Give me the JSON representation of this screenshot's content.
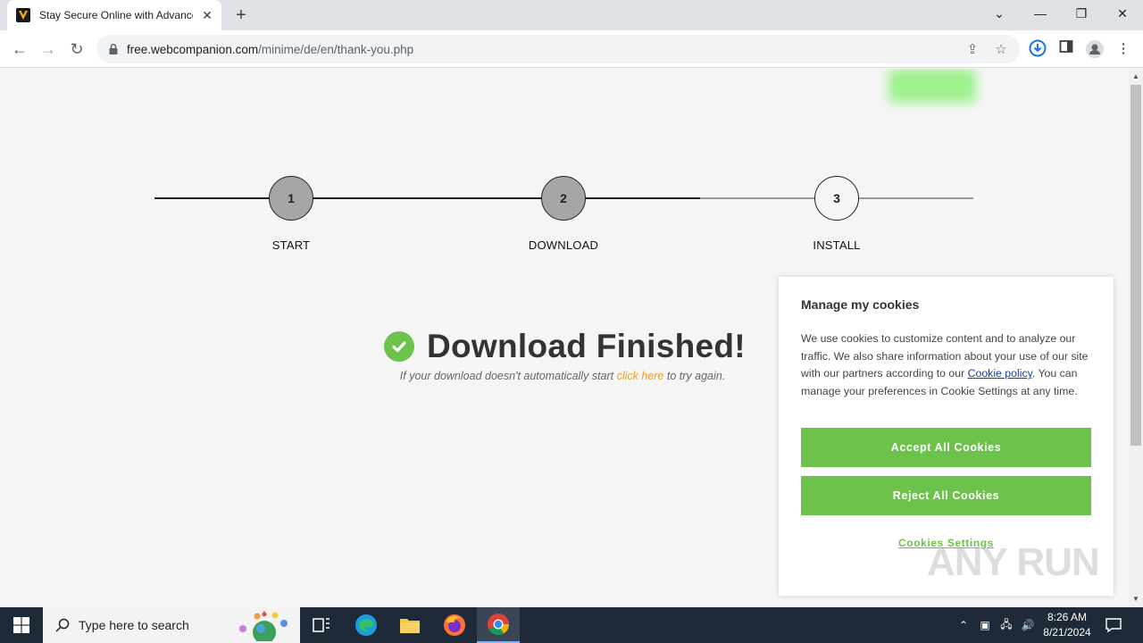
{
  "browser": {
    "tab_title": "Stay Secure Online with Advance",
    "url_domain": "free.webcompanion.com",
    "url_path": "/minime/de/en/thank-you.php"
  },
  "steps": [
    {
      "number": "1",
      "label": "START"
    },
    {
      "number": "2",
      "label": "DOWNLOAD"
    },
    {
      "number": "3",
      "label": "INSTALL"
    }
  ],
  "main": {
    "headline": "Download Finished!",
    "sub_before": "If your download doesn't automatically start ",
    "sub_link": "click here",
    "sub_after": " to try again."
  },
  "cookie": {
    "title": "Manage my cookies",
    "text_before": "We use cookies to customize content and to analyze our traffic. We also share information about your use of our site with our partners according to our ",
    "policy_link": "Cookie policy",
    "text_after": ". You can manage your preferences in Cookie Settings at any time.",
    "accept_label": "Accept All Cookies",
    "reject_label": "Reject All Cookies",
    "settings_label": "Cookies Settings"
  },
  "watermark": "ANY RUN",
  "taskbar": {
    "search_placeholder": "Type here to search",
    "time": "8:26 AM",
    "date": "8/21/2024"
  },
  "colors": {
    "accent_green": "#6cc24a",
    "link_orange": "#f0a020",
    "policy_link": "#1a3d9c"
  }
}
